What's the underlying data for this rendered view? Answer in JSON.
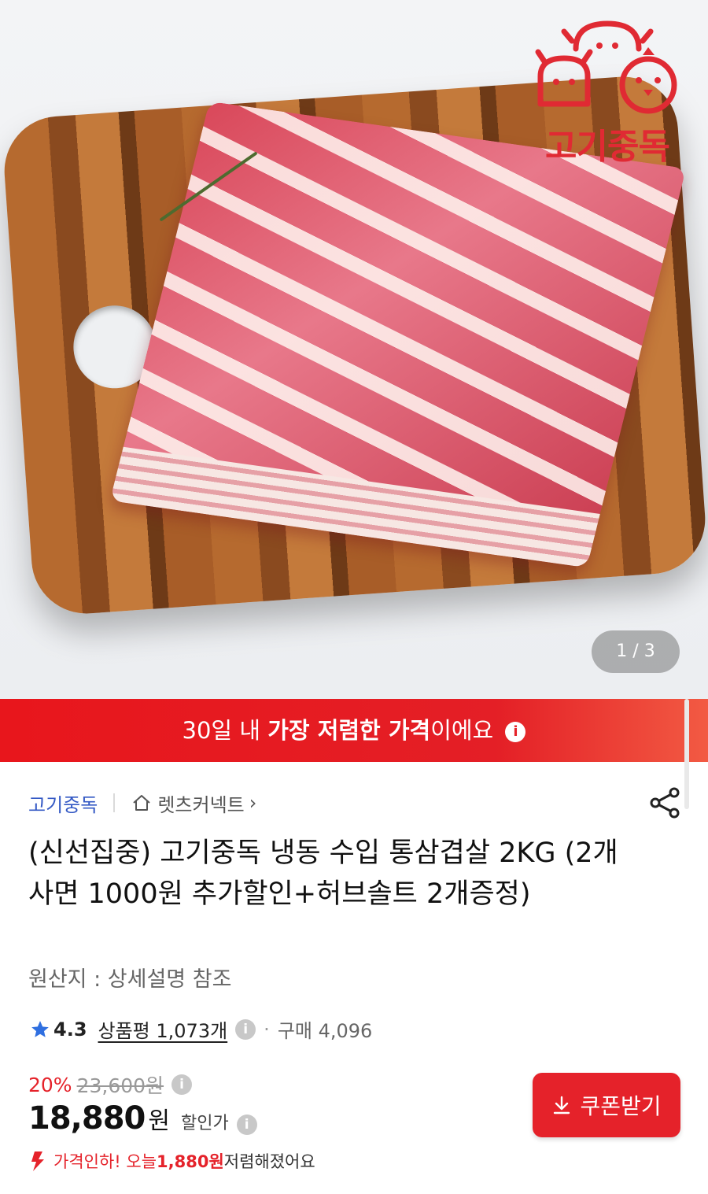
{
  "gallery": {
    "counter": "1 / 3",
    "brand_logo_text": "고기중독"
  },
  "banner": {
    "prefix": "30일 내 ",
    "highlight": "가장 저렴한 가격",
    "suffix": "이에요"
  },
  "seller": {
    "brand": "고기중독",
    "store": "렛츠커넥트",
    "store_chevron": "›"
  },
  "product": {
    "title": "(신선집중) 고기중독 냉동 수입 통삼겹살 2KG (2개사면 1000원 추가할인+허브솔트 2개증정)",
    "origin": "원산지 : 상세설명 참조"
  },
  "rating": {
    "score": "4.3",
    "reviews": "상품평 1,073개",
    "separator": "·",
    "purchases": "구매 4,096"
  },
  "price": {
    "discount": "20%",
    "original": "23,600원",
    "sale": "18,880",
    "currency": "원",
    "sale_label": "할인가",
    "note_prefix": "가격인하! 오늘 ",
    "note_amount": "1,880원",
    "note_suffix": " 저렴해졌어요"
  },
  "actions": {
    "coupon": "쿠폰받기"
  },
  "colors": {
    "brand_red": "#e5222a",
    "link_blue": "#3358c4",
    "star_blue": "#2f6fe0"
  }
}
